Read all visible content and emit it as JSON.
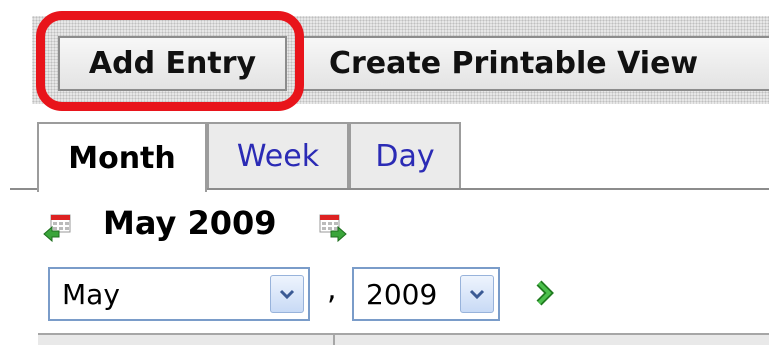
{
  "toolbar": {
    "add_entry_label": "Add Entry",
    "printable_view_label": "Create Printable View",
    "highlight_color": "#e8141b"
  },
  "tabs": [
    {
      "label": "Month",
      "active": true
    },
    {
      "label": "Week",
      "active": false
    },
    {
      "label": "Day",
      "active": false
    }
  ],
  "calendar": {
    "title": "May 2009",
    "prev_icon": "calendar-prev-icon",
    "next_icon": "calendar-next-icon"
  },
  "selectors": {
    "month_value": "May",
    "separator": ",",
    "year_value": "2009",
    "go_icon": "green-arrow-right-icon"
  }
}
